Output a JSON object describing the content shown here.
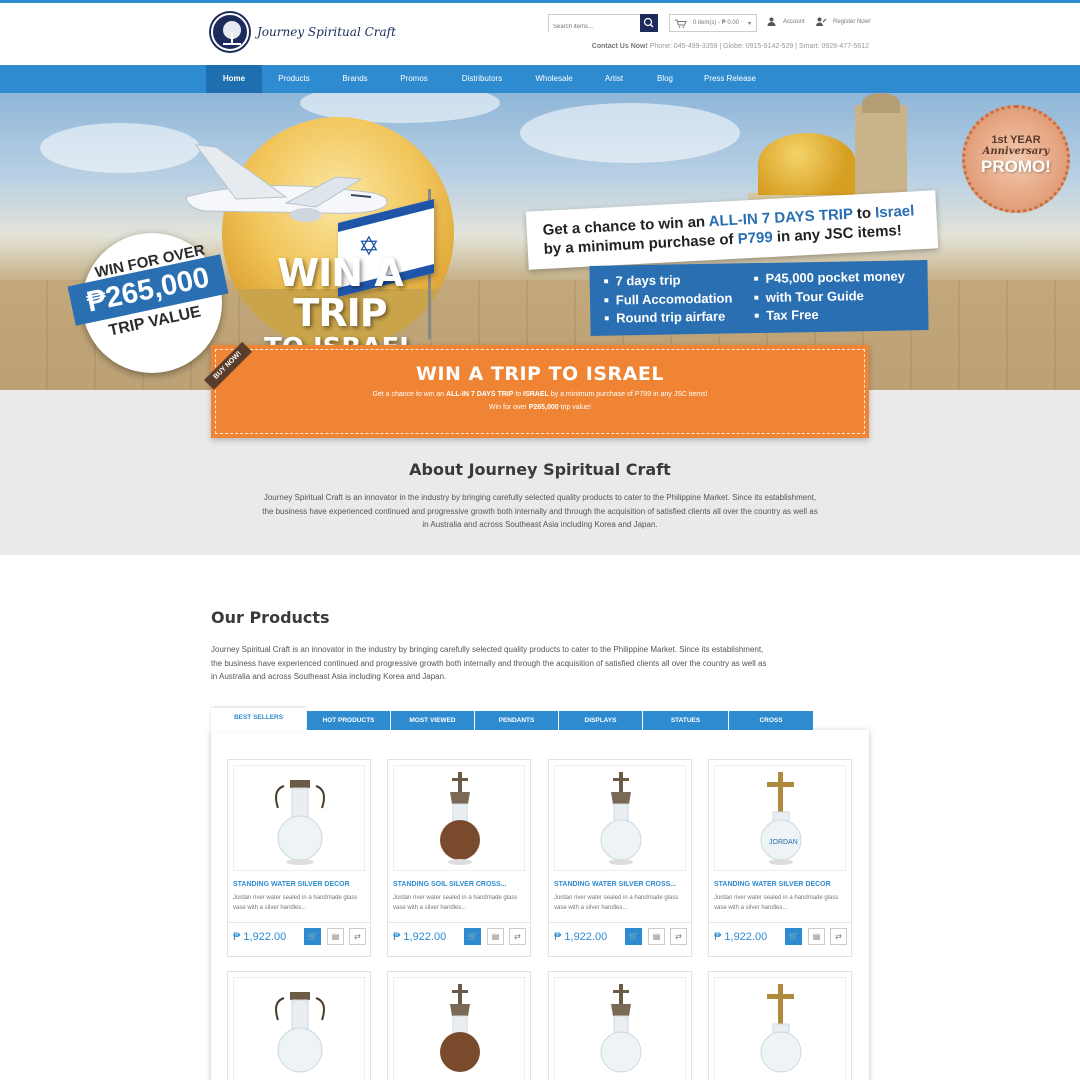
{
  "brand": {
    "name": "Journey Spiritual Craft"
  },
  "header": {
    "search_placeholder": "Search items...",
    "cart_label": "0 item(s) - ₱ 0.00",
    "account_label": "Account",
    "register_label": "Register Now!",
    "contact_label": "Contact Us Now!",
    "contact_numbers": "Phone: 045-499-3359 | Globe: 0915-9142-529 | Smart: 0928-477-5612"
  },
  "nav": {
    "items": [
      "Home",
      "Products",
      "Brands",
      "Promos",
      "Distributors",
      "Wholesale",
      "Artist",
      "Blog",
      "Press Release"
    ],
    "active": "Home"
  },
  "banner": {
    "win_line1": "WIN A TRIP",
    "win_line2": "TO ISRAEL",
    "badge_top": "WIN FOR OVER",
    "badge_amount": "₱265,000",
    "badge_bottom": "TRIP VALUE",
    "callout_pre": "Get a chance to win an ",
    "callout_hl1": "ALL-IN 7 DAYS TRIP",
    "callout_mid": " to ",
    "callout_hl2": "Israel",
    "callout_l2a": "by a minimum purchase of ",
    "callout_hl3": "P799",
    "callout_l2b": " in any JSC items!",
    "features": [
      "7 days trip",
      "P45,000 pocket money",
      "Full Accomodation",
      "with Tour Guide",
      "Round trip airfare",
      "Tax Free"
    ],
    "seal_line1": "1st YEAR",
    "seal_line2": "Anniversary",
    "seal_line3": "PROMO!"
  },
  "promo_box": {
    "ribbon": "BUY NOW!",
    "title": "WIN A TRIP TO ISRAEL",
    "line1_a": "Get a chance to win an ",
    "line1_b": "ALL-IN 7 DAYS TRIP",
    "line1_c": " to ",
    "line1_d": "ISRAEL",
    "line1_e": " by a minimum purchase of P799 in any JSC items!",
    "line2_a": "Win for over ",
    "line2_b": "P265,000",
    "line2_c": " trip value!"
  },
  "about": {
    "title": "About Journey Spiritual Craft",
    "text": "Journey Spiritual Craft is an innovator in the industry by bringing carefully selected quality products to cater to the Philippine Market. Since its establishment, the business have experienced continued and progressive growth both internally and through the acquisition of satisfied clients all over the country as well as in Australia and across Southeast Asia including Korea and Japan."
  },
  "products": {
    "title": "Our Products",
    "text": "Journey Spiritual Craft is an innovator in the industry by bringing carefully selected quality products to cater to the Philippine Market. Since its establishment, the business have experienced continued and progressive growth both internally and through the acquisition of satisfied clients all over the country as well as in Australia and across Southeast Asia including Korea and Japan.",
    "tabs": [
      "BEST SELLERS",
      "HOT PRODUCTS",
      "MOST VIEWED",
      "PENDANTS",
      "DISPLAYS",
      "STATUES",
      "CROSS"
    ],
    "active_tab": "BEST SELLERS",
    "items": [
      {
        "name": "STANDING WATER SILVER DECOR",
        "desc": "Jordan river water sealed in a handmade glass vase with a silver handles...",
        "price": "₱ 1,922.00"
      },
      {
        "name": "STANDING SOIL SILVER CROSS...",
        "desc": "Jordan river water sealed in a handmade glass vase with a silver handles...",
        "price": "₱ 1,922.00"
      },
      {
        "name": "STANDING WATER SILVER CROSS...",
        "desc": "Jordan river water sealed in a handmade glass vase with a silver handles...",
        "price": "₱ 1,922.00"
      },
      {
        "name": "STANDING WATER SILVER DECOR",
        "desc": "Jordan river water sealed in a handmade glass vase with a silver handles...",
        "price": "₱ 1,922.00"
      }
    ]
  },
  "colors": {
    "accent": "#2e8bd0",
    "navy": "#1c2a5c",
    "orange": "#ef8434",
    "banner_blue": "#2a6fb2"
  }
}
